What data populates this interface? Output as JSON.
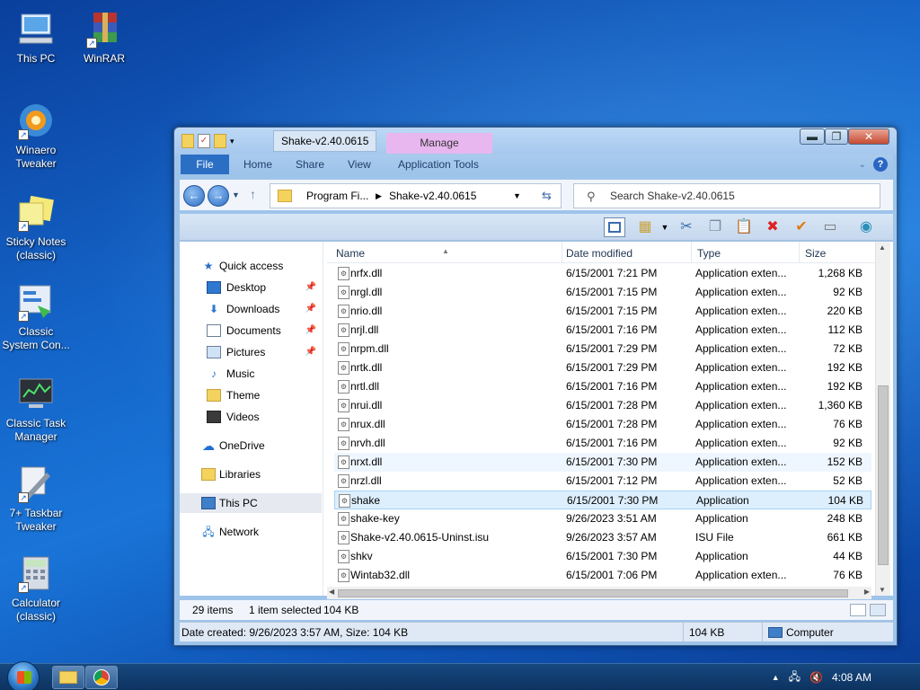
{
  "desktop": {
    "icons": [
      {
        "label": "This PC"
      },
      {
        "label": "WinRAR"
      },
      {
        "label": "Winaero Tweaker"
      },
      {
        "label": "Sticky Notes (classic)"
      },
      {
        "label": "Classic System Con..."
      },
      {
        "label": "Classic Task Manager"
      },
      {
        "label": "7+ Taskbar Tweaker"
      },
      {
        "label": "Calculator (classic)"
      }
    ]
  },
  "window": {
    "title": "Shake-v2.40.0615",
    "contextual_tab": "Manage",
    "ribbon_tabs": [
      "File",
      "Home",
      "Share",
      "View",
      "Application Tools"
    ],
    "address": {
      "crumbs": [
        "Program Fi...",
        "Shake-v2.40.0615"
      ]
    },
    "search": {
      "placeholder": "Search Shake-v2.40.0615"
    },
    "nav": [
      {
        "label": "Quick access",
        "icon": "star-icon"
      },
      {
        "label": "Desktop",
        "icon": "desktop-icon",
        "pinned": true
      },
      {
        "label": "Downloads",
        "icon": "download-icon",
        "pinned": true
      },
      {
        "label": "Documents",
        "icon": "documents-icon",
        "pinned": true
      },
      {
        "label": "Pictures",
        "icon": "pictures-icon",
        "pinned": true
      },
      {
        "label": "Music",
        "icon": "music-icon"
      },
      {
        "label": "Theme",
        "icon": "folder-icon"
      },
      {
        "label": "Videos",
        "icon": "videos-icon"
      },
      {
        "label": "OneDrive",
        "icon": "cloud-icon"
      },
      {
        "label": "Libraries",
        "icon": "libraries-icon"
      },
      {
        "label": "This PC",
        "icon": "computer-icon"
      },
      {
        "label": "Network",
        "icon": "network-icon"
      }
    ],
    "columns": [
      "Name",
      "Date modified",
      "Type",
      "Size"
    ],
    "files": [
      {
        "name": "nrfx.dll",
        "date": "6/15/2001 7:21 PM",
        "type": "Application exten...",
        "size": "1,268 KB"
      },
      {
        "name": "nrgl.dll",
        "date": "6/15/2001 7:15 PM",
        "type": "Application exten...",
        "size": "92 KB"
      },
      {
        "name": "nrio.dll",
        "date": "6/15/2001 7:15 PM",
        "type": "Application exten...",
        "size": "220 KB"
      },
      {
        "name": "nrjl.dll",
        "date": "6/15/2001 7:16 PM",
        "type": "Application exten...",
        "size": "112 KB"
      },
      {
        "name": "nrpm.dll",
        "date": "6/15/2001 7:29 PM",
        "type": "Application exten...",
        "size": "72 KB"
      },
      {
        "name": "nrtk.dll",
        "date": "6/15/2001 7:29 PM",
        "type": "Application exten...",
        "size": "192 KB"
      },
      {
        "name": "nrtl.dll",
        "date": "6/15/2001 7:16 PM",
        "type": "Application exten...",
        "size": "192 KB"
      },
      {
        "name": "nrui.dll",
        "date": "6/15/2001 7:28 PM",
        "type": "Application exten...",
        "size": "1,360 KB"
      },
      {
        "name": "nrux.dll",
        "date": "6/15/2001 7:28 PM",
        "type": "Application exten...",
        "size": "76 KB"
      },
      {
        "name": "nrvh.dll",
        "date": "6/15/2001 7:16 PM",
        "type": "Application exten...",
        "size": "92 KB"
      },
      {
        "name": "nrxt.dll",
        "date": "6/15/2001 7:30 PM",
        "type": "Application exten...",
        "size": "152 KB"
      },
      {
        "name": "nrzl.dll",
        "date": "6/15/2001 7:12 PM",
        "type": "Application exten...",
        "size": "52 KB"
      },
      {
        "name": "shake",
        "date": "6/15/2001 7:30 PM",
        "type": "Application",
        "size": "104 KB"
      },
      {
        "name": "shake-key",
        "date": "9/26/2023 3:51 AM",
        "type": "Application",
        "size": "248 KB"
      },
      {
        "name": "Shake-v2.40.0615-Uninst.isu",
        "date": "9/26/2023 3:57 AM",
        "type": "ISU File",
        "size": "661 KB"
      },
      {
        "name": "shkv",
        "date": "6/15/2001 7:30 PM",
        "type": "Application",
        "size": "44 KB"
      },
      {
        "name": "Wintab32.dll",
        "date": "6/15/2001 7:06 PM",
        "type": "Application exten...",
        "size": "76 KB"
      }
    ],
    "status": {
      "count": "29 items",
      "selected": "1 item selected",
      "selected_size": "104 KB"
    },
    "details": {
      "info": "Date created: 9/26/2023 3:57 AM, Size: 104 KB",
      "size": "104 KB",
      "location": "Computer"
    }
  },
  "taskbar": {
    "clock": "4:08 AM"
  },
  "colors": {
    "accent": "#2b6fc4",
    "manage_tab": "#e9b7f0",
    "selection": "#ddeefd",
    "close": "#c74a33"
  }
}
